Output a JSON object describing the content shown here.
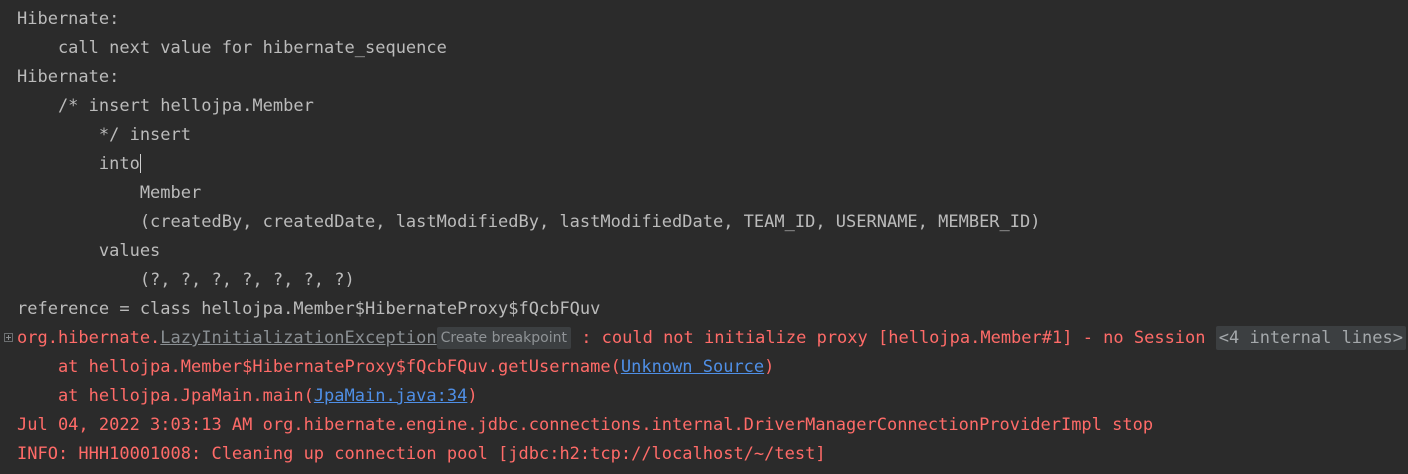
{
  "lines": {
    "l1": "Hibernate:",
    "l2": "    call next value for hibernate_sequence",
    "l3": "Hibernate:",
    "l4": "    /* insert hellojpa.Member",
    "l5": "        */ insert",
    "l6": "        into",
    "l7": "            Member",
    "l8": "            (createdBy, createdDate, lastModifiedBy, lastModifiedDate, TEAM_ID, USERNAME, MEMBER_ID)",
    "l9": "        values",
    "l10": "            (?, ?, ?, ?, ?, ?, ?)",
    "l11": "reference = class hellojpa.Member$HibernateProxy$fQcbFQuv"
  },
  "exception": {
    "prefix": "org.hibernate.",
    "class_link": "LazyInitializationException",
    "breakpoint_badge": "Create breakpoint",
    "message": " : could not initialize proxy [hellojpa.Member#1] - no Session ",
    "internal_lines": "<4 internal lines>"
  },
  "stack": {
    "frame1_prefix": "    at hellojpa.Member$HibernateProxy$fQcbFQuv.getUsername(",
    "frame1_link": "Unknown Source",
    "frame1_suffix": ")",
    "frame2_prefix": "    at hellojpa.JpaMain.main(",
    "frame2_link": "JpaMain.java:34",
    "frame2_suffix": ")"
  },
  "log": {
    "line1": "Jul 04, 2022 3:03:13 AM org.hibernate.engine.jdbc.connections.internal.DriverManagerConnectionProviderImpl stop",
    "line2": "INFO: HHH10001008: Cleaning up connection pool [jdbc:h2:tcp://localhost/~/test]"
  },
  "colors": {
    "background": "#2b2b2b",
    "text": "#bbbbbb",
    "error": "#ff6b68",
    "link": "#4f8fe6"
  }
}
